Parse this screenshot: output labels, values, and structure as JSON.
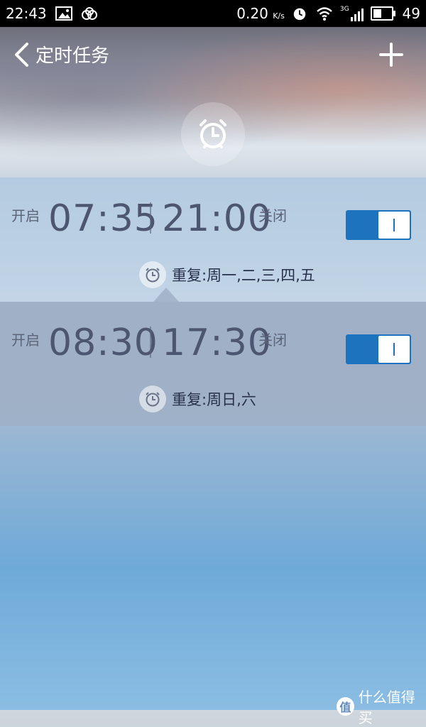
{
  "status_bar": {
    "time": "22:43",
    "network_speed": "0.20",
    "network_speed_unit": "K/s",
    "network_type": "3G",
    "battery": "49",
    "icons": [
      "image-icon",
      "cloud-sync-icon",
      "alarm-icon",
      "wifi-icon",
      "signal-icon",
      "battery-icon"
    ]
  },
  "header": {
    "title": "定时任务",
    "back_icon": "chevron-left-icon",
    "add_icon": "plus-icon",
    "center_icon": "alarm-clock-icon"
  },
  "tasks": [
    {
      "on_label": "开启",
      "on_time": "07:35",
      "off_time": "21:00",
      "off_label": "关闭",
      "toggle_on": true,
      "repeat": "重复:周一,二,三,四,五"
    },
    {
      "on_label": "开启",
      "on_time": "08:30",
      "off_time": "17:30",
      "off_label": "关闭",
      "toggle_on": true,
      "repeat": "重复:周日,六"
    }
  ],
  "watermark": {
    "logo": "值",
    "text": "什么值得买"
  },
  "colors": {
    "toggle_accent": "#1e73bf",
    "status_bar_bg": "#000000",
    "time_text": "#4d5670"
  }
}
